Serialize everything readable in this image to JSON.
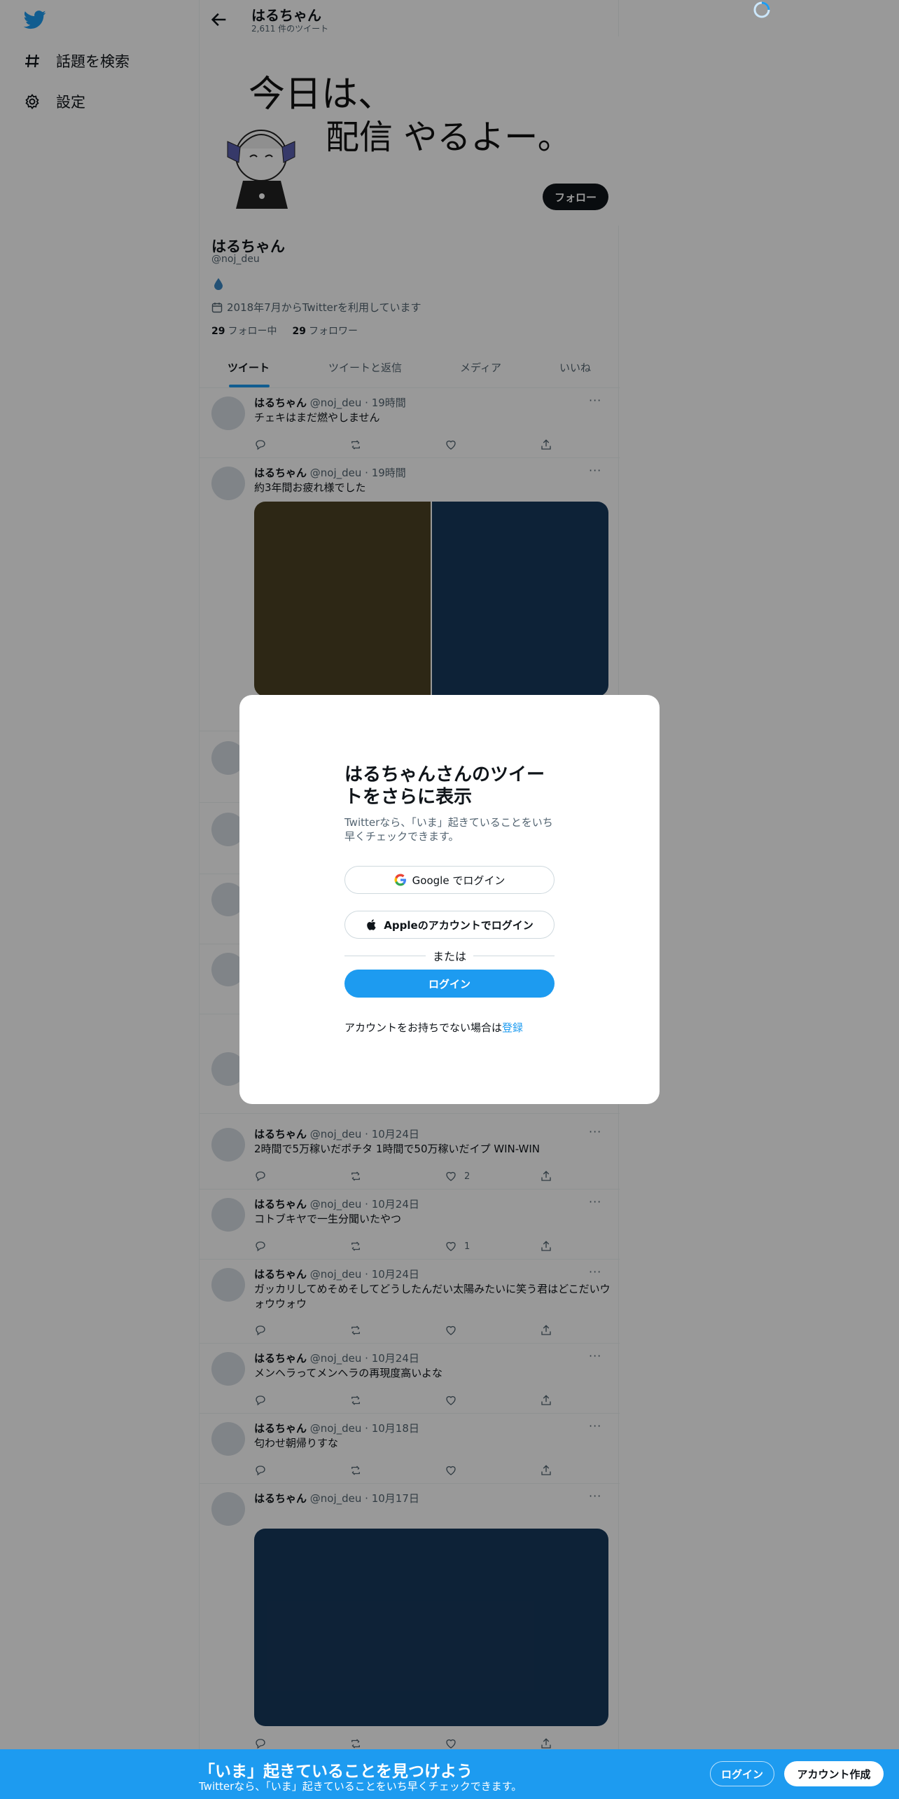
{
  "nav": {
    "items": [
      {
        "label": "話題を検索",
        "icon": "hashtag-icon"
      },
      {
        "label": "設定",
        "icon": "gear-icon"
      }
    ]
  },
  "topbar": {
    "name": "はるちゃん",
    "tweet_count": "2,611 件のツイート"
  },
  "profile": {
    "follow_label": "フォロー",
    "name": "はるちゃん",
    "handle": "@noj_deu",
    "joined": "2018年7月からTwitterを利用しています",
    "following_count": "29",
    "following_label": "フォロー中",
    "followers_count": "29",
    "followers_label": "フォロワー",
    "banner_text_line1": "今日は、",
    "banner_text_line2": "配信 やるよー。"
  },
  "tabs": [
    "ツイート",
    "ツイートと返信",
    "メディア",
    "いいね"
  ],
  "tweets": [
    {
      "name": "はるちゃん",
      "meta": "@noj_deu · 19時間",
      "text": "チェキはまだ燃やしません",
      "likes": ""
    },
    {
      "name": "はるちゃん",
      "meta": "@noj_deu · 19時間",
      "text": "約3年間お疲れ様でした",
      "likes": ""
    },
    {
      "name": "はるちゃん",
      "meta": "@noj_deu · 10月24日",
      "text": "2時間で5万稼いだポチタ 1時間で50万稼いだイプ WIN-WIN",
      "likes": "2"
    },
    {
      "name": "はるちゃん",
      "meta": "@noj_deu · 10月24日",
      "text": "コトブキヤで一生分聞いたやつ",
      "likes": "1"
    },
    {
      "name": "はるちゃん",
      "meta": "@noj_deu · 10月24日",
      "text": "ガッカリしてめそめそしてどうしたんだい太陽みたいに笑う君はどこだいウォウウォウ",
      "likes": ""
    },
    {
      "name": "はるちゃん",
      "meta": "@noj_deu · 10月24日",
      "text": "メンヘラってメンヘラの再現度高いよな",
      "likes": ""
    },
    {
      "name": "はるちゃん",
      "meta": "@noj_deu · 10月18日",
      "text": "匂わせ朝帰りすな",
      "likes": ""
    },
    {
      "name": "はるちゃん",
      "meta": "@noj_deu · 10月17日",
      "text": "",
      "likes": ""
    }
  ],
  "modal": {
    "title": "はるちゃんさんのツイートをさらに表示",
    "subtitle": "Twitterなら、「いま」起きていることをいち早くチェックできます。",
    "google_label": "Google でログイン",
    "apple_label": "Appleのアカウントでログイン",
    "or_label": "または",
    "login_label": "ログイン",
    "signup_prompt": "アカウントをお持ちでない場合は",
    "signup_link": "登録"
  },
  "bottombar": {
    "title": "「いま」起きていることを見つけよう",
    "subtitle": "Twitterなら、「いま」起きていることをいち早くチェックできます。",
    "login_label": "ログイン",
    "signup_label": "アカウント作成"
  },
  "colors": {
    "accent": "#1d9bf0",
    "dark": "#0f1419",
    "media_olive": "#4b4224",
    "media_navy": "#17395c"
  }
}
